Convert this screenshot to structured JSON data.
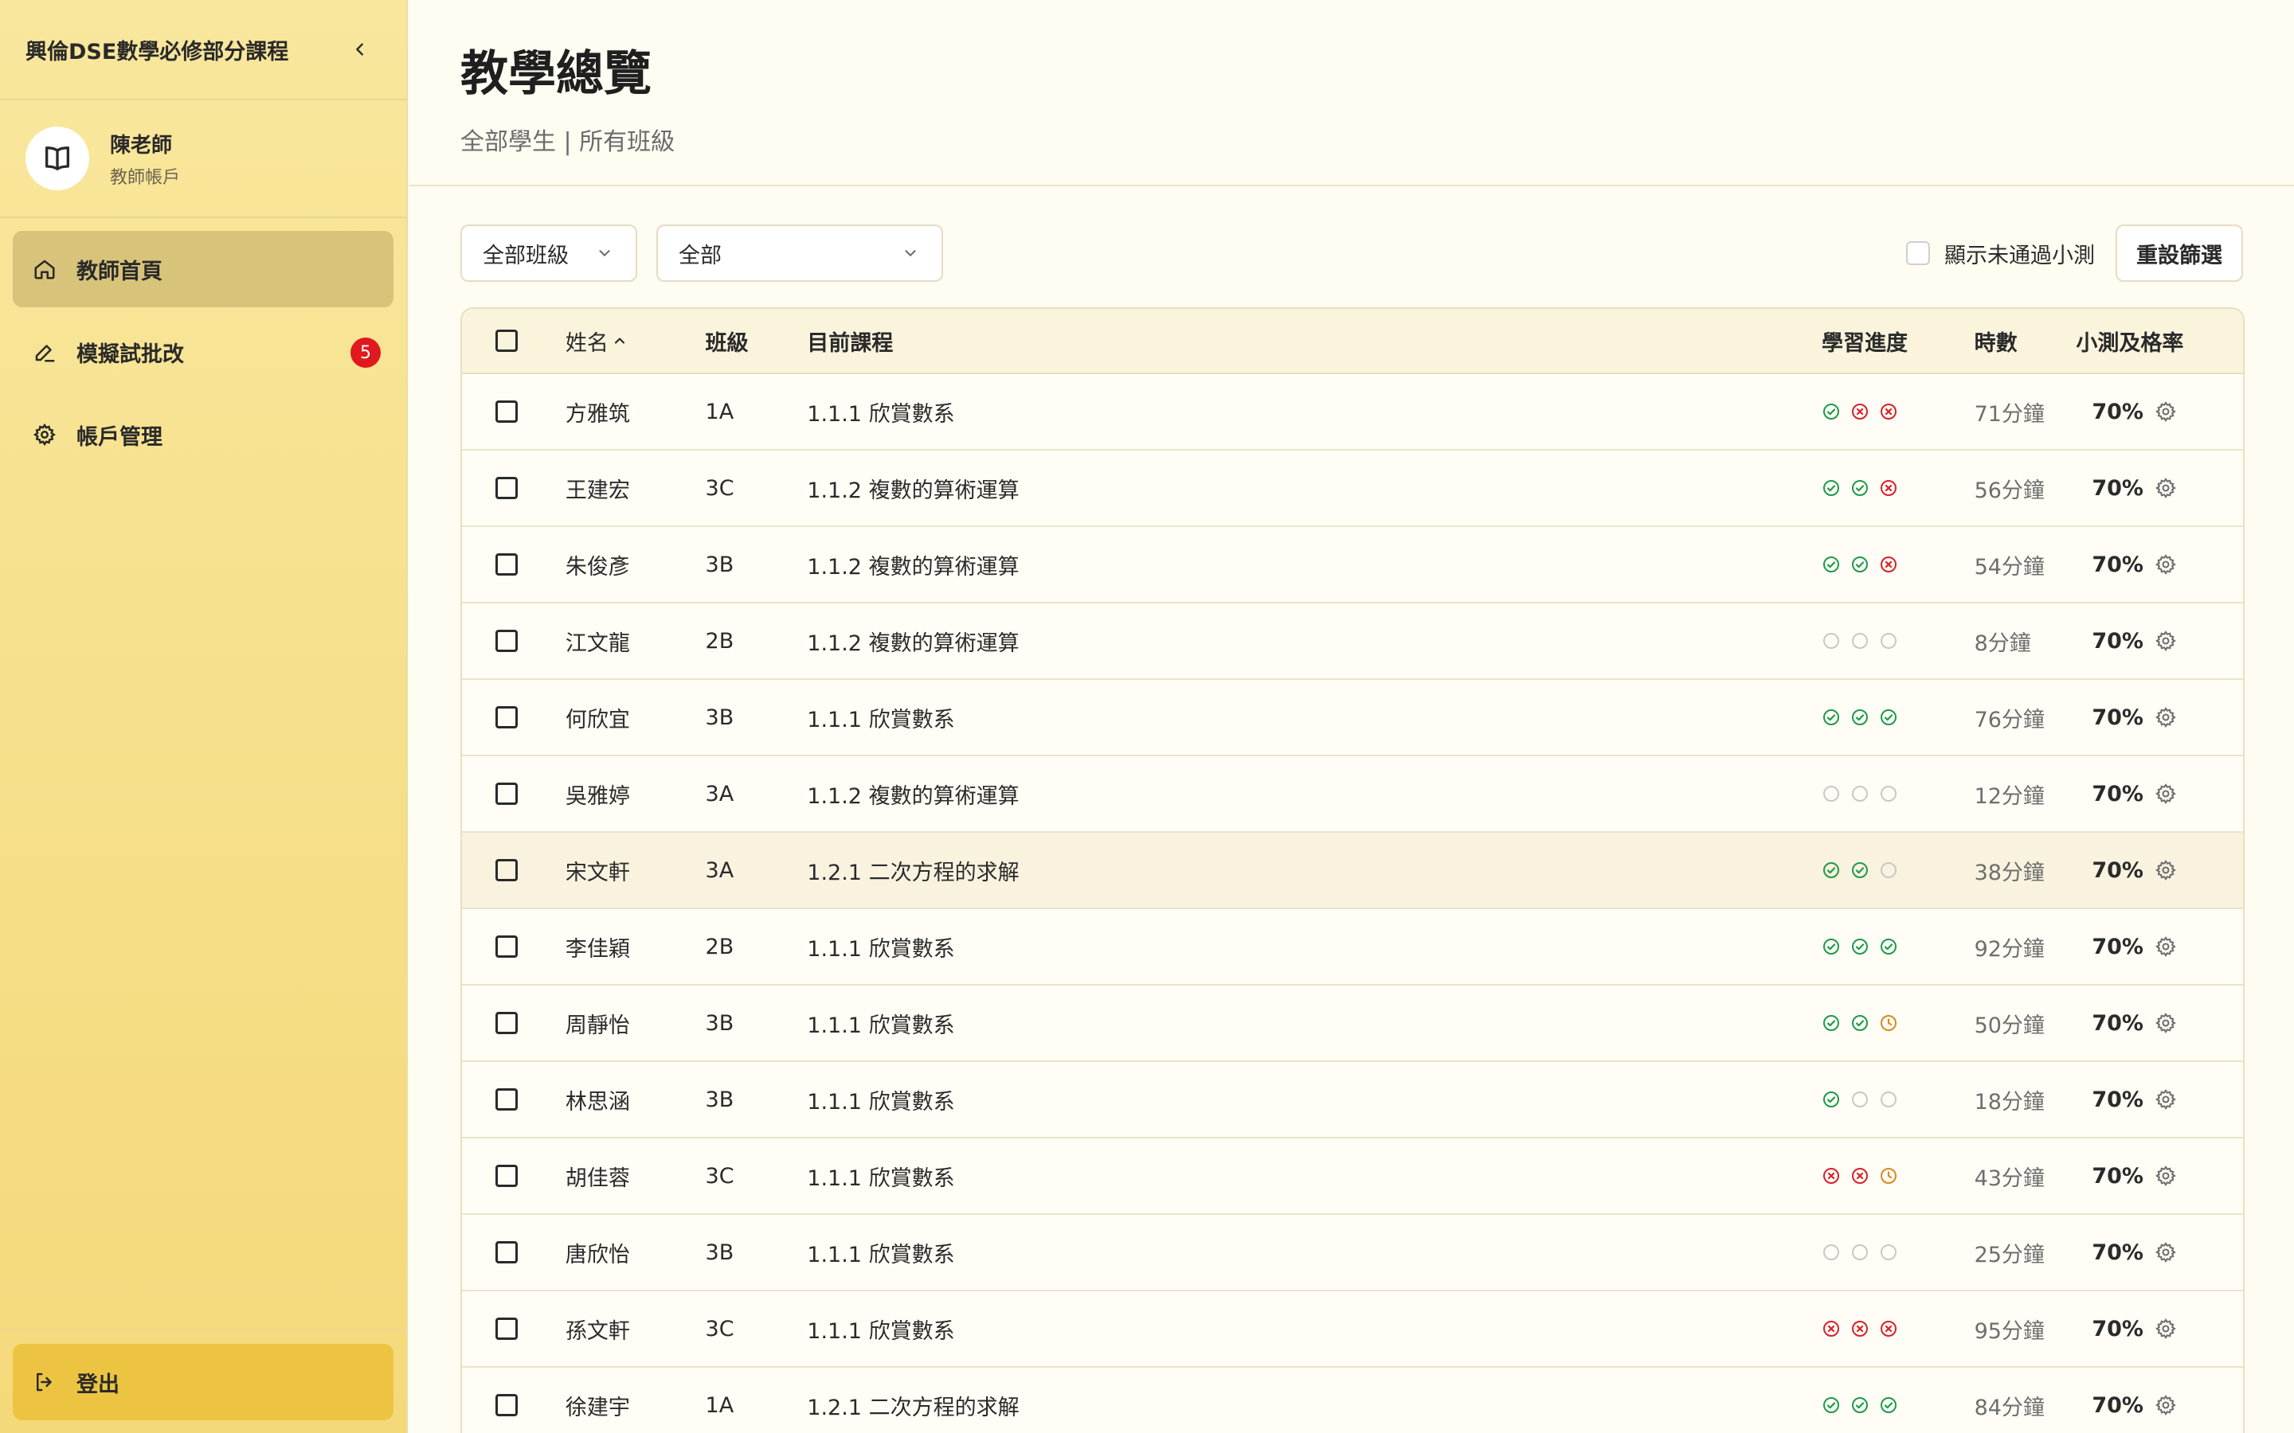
{
  "app": {
    "title": "興倫DSE數學必修部分課程"
  },
  "profile": {
    "name": "陳老師",
    "role": "教師帳戶"
  },
  "nav": {
    "home": "教師首頁",
    "marking": "模擬試批改",
    "marking_badge": "5",
    "accounts": "帳戶管理",
    "logout": "登出"
  },
  "page": {
    "title": "教學總覽",
    "subtitle": "全部學生 | 所有班級"
  },
  "filters": {
    "class_select": "全部班級",
    "status_select": "全部",
    "show_failed_label": "顯示未通過小測",
    "reset_label": "重設篩選"
  },
  "table": {
    "headers": {
      "name": "姓名",
      "class": "班級",
      "course": "目前課程",
      "progress": "學習進度",
      "time": "時數",
      "pass": "小測及格率"
    },
    "rows": [
      {
        "name": "方雅筑",
        "class": "1A",
        "course": "1.1.1 欣賞數系",
        "progress": [
          "pass",
          "fail",
          "fail"
        ],
        "time": "71分鐘",
        "pass": "70%"
      },
      {
        "name": "王建宏",
        "class": "3C",
        "course": "1.1.2 複數的算術運算",
        "progress": [
          "pass",
          "pass",
          "fail"
        ],
        "time": "56分鐘",
        "pass": "70%"
      },
      {
        "name": "朱俊彥",
        "class": "3B",
        "course": "1.1.2 複數的算術運算",
        "progress": [
          "pass",
          "pass",
          "fail"
        ],
        "time": "54分鐘",
        "pass": "70%"
      },
      {
        "name": "江文龍",
        "class": "2B",
        "course": "1.1.2 複數的算術運算",
        "progress": [
          "none",
          "none",
          "none"
        ],
        "time": "8分鐘",
        "pass": "70%"
      },
      {
        "name": "何欣宜",
        "class": "3B",
        "course": "1.1.1 欣賞數系",
        "progress": [
          "pass",
          "pass",
          "pass"
        ],
        "time": "76分鐘",
        "pass": "70%"
      },
      {
        "name": "吳雅婷",
        "class": "3A",
        "course": "1.1.2 複數的算術運算",
        "progress": [
          "none",
          "none",
          "none"
        ],
        "time": "12分鐘",
        "pass": "70%"
      },
      {
        "name": "宋文軒",
        "class": "3A",
        "course": "1.2.1 二次方程的求解",
        "progress": [
          "pass",
          "pass",
          "none"
        ],
        "time": "38分鐘",
        "pass": "70%"
      },
      {
        "name": "李佳穎",
        "class": "2B",
        "course": "1.1.1 欣賞數系",
        "progress": [
          "pass",
          "pass",
          "pass"
        ],
        "time": "92分鐘",
        "pass": "70%"
      },
      {
        "name": "周靜怡",
        "class": "3B",
        "course": "1.1.1 欣賞數系",
        "progress": [
          "pass",
          "pass",
          "pending"
        ],
        "time": "50分鐘",
        "pass": "70%"
      },
      {
        "name": "林思涵",
        "class": "3B",
        "course": "1.1.1 欣賞數系",
        "progress": [
          "pass",
          "none",
          "none"
        ],
        "time": "18分鐘",
        "pass": "70%"
      },
      {
        "name": "胡佳蓉",
        "class": "3C",
        "course": "1.1.1 欣賞數系",
        "progress": [
          "fail",
          "fail",
          "pending"
        ],
        "time": "43分鐘",
        "pass": "70%"
      },
      {
        "name": "唐欣怡",
        "class": "3B",
        "course": "1.1.1 欣賞數系",
        "progress": [
          "none",
          "none",
          "none"
        ],
        "time": "25分鐘",
        "pass": "70%"
      },
      {
        "name": "孫文軒",
        "class": "3C",
        "course": "1.1.1 欣賞數系",
        "progress": [
          "fail",
          "fail",
          "fail"
        ],
        "time": "95分鐘",
        "pass": "70%"
      },
      {
        "name": "徐建宇",
        "class": "1A",
        "course": "1.2.1 二次方程的求解",
        "progress": [
          "pass",
          "pass",
          "pass"
        ],
        "time": "84分鐘",
        "pass": "70%"
      }
    ]
  },
  "colors": {
    "pass": "#1e9a4a",
    "fail": "#d9202a",
    "pending": "#d98a1e",
    "none": "#c8c8c8",
    "sidebar_bg": "#f6e08a",
    "active_nav": "#d8c37a",
    "logout_bg": "#edc442"
  },
  "icons": {
    "collapse": "chevron-left-icon",
    "avatar": "open-book-icon",
    "home": "home-icon",
    "marking": "pencil-icon",
    "accounts": "gear-icon",
    "logout": "logout-icon",
    "sort": "chevron-up-icon",
    "row_action": "gear-icon"
  }
}
